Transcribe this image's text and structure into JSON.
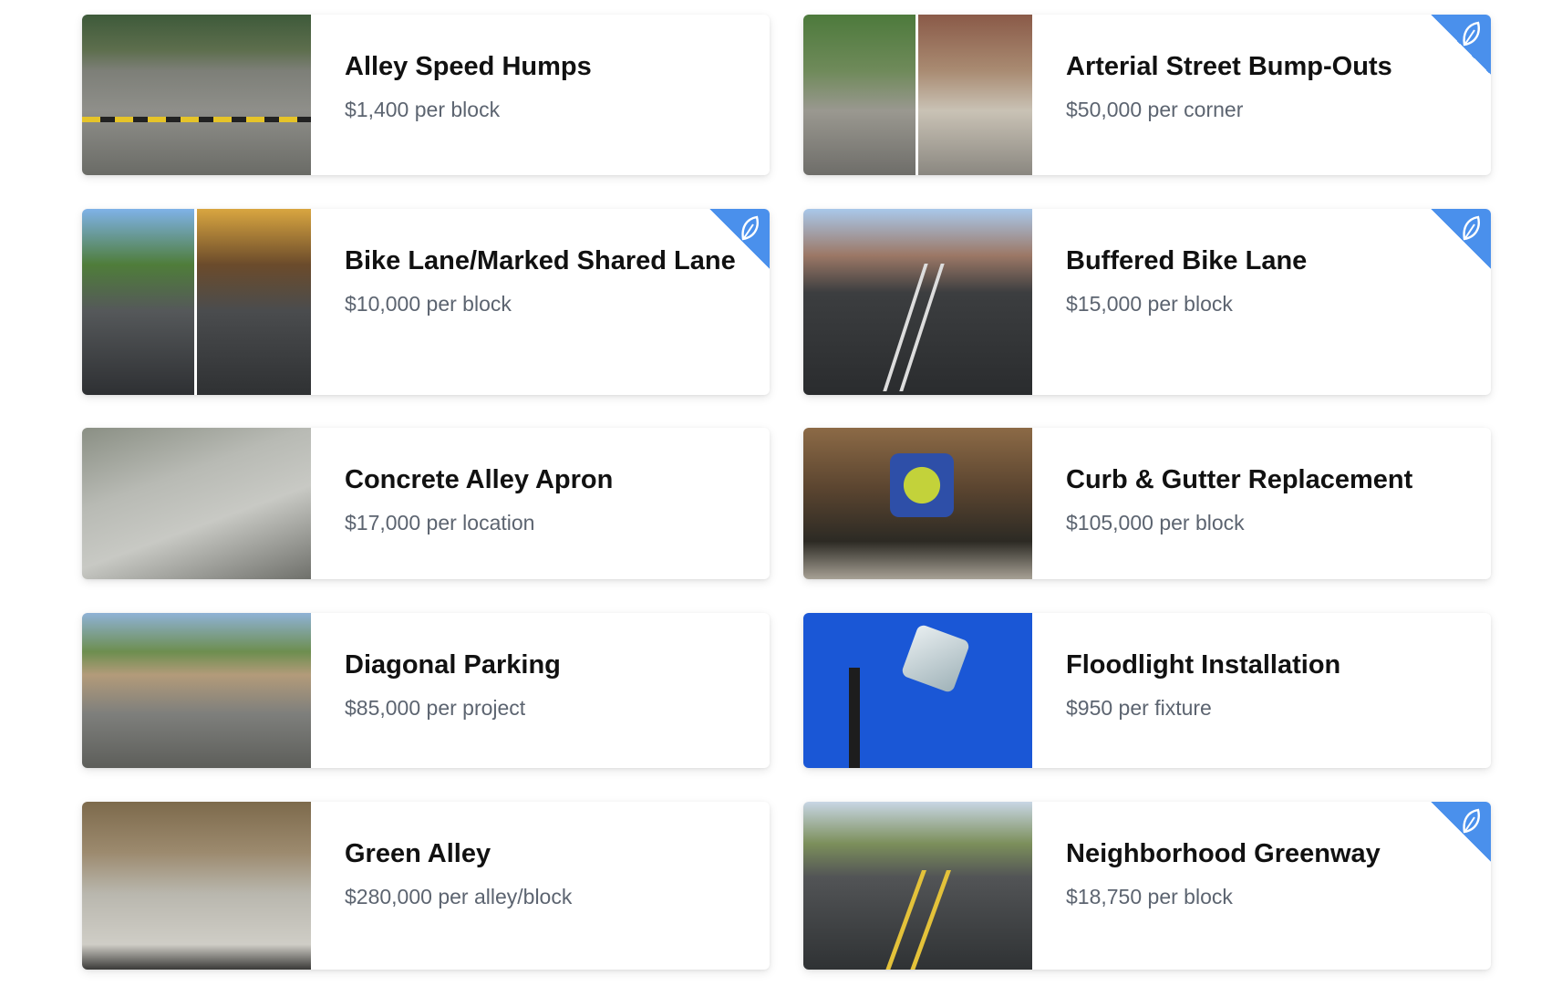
{
  "colors": {
    "ribbon": "#4a90ec",
    "title": "#111111",
    "price": "#5c6470"
  },
  "cards": [
    {
      "title": "Alley Speed Humps",
      "price": "$1,400 per block",
      "badge": false,
      "badge_icon": "leaf-icon"
    },
    {
      "title": "Arterial Street Bump-Outs",
      "price": "$50,000 per corner",
      "badge": true,
      "badge_icon": "leaf-icon"
    },
    {
      "title": "Bike Lane/Marked Shared Lane",
      "price": "$10,000 per block",
      "badge": true,
      "badge_icon": "leaf-icon"
    },
    {
      "title": "Buffered Bike Lane",
      "price": "$15,000 per block",
      "badge": true,
      "badge_icon": "leaf-icon"
    },
    {
      "title": "Concrete Alley Apron",
      "price": "$17,000 per location",
      "badge": false,
      "badge_icon": "leaf-icon"
    },
    {
      "title": "Curb & Gutter Replacement",
      "price": "$105,000 per block",
      "badge": false,
      "badge_icon": "leaf-icon"
    },
    {
      "title": "Diagonal Parking",
      "price": "$85,000 per project",
      "badge": false,
      "badge_icon": "leaf-icon"
    },
    {
      "title": "Floodlight Installation",
      "price": "$950 per fixture",
      "badge": false,
      "badge_icon": "leaf-icon"
    },
    {
      "title": "Green Alley",
      "price": "$280,000 per alley/block",
      "badge": false,
      "badge_icon": "leaf-icon"
    },
    {
      "title": "Neighborhood Greenway",
      "price": "$18,750 per block",
      "badge": true,
      "badge_icon": "leaf-icon"
    }
  ]
}
